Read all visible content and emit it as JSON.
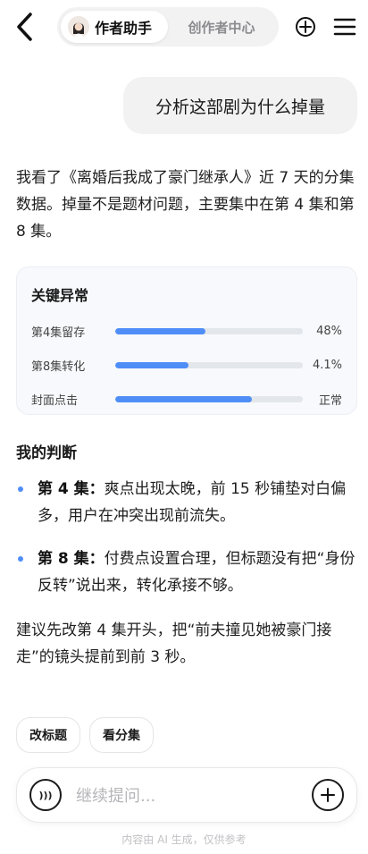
{
  "header": {
    "active_tab": "作者助手",
    "inactive_tab": "创作者中心",
    "icons": {
      "back": "back-chevron-icon",
      "add": "plus-circle-icon",
      "menu": "menu-icon"
    }
  },
  "chat": {
    "user_message": "分析这部剧为什么掉量",
    "answer_intro": "我看了《离婚后我成了豪门继承人》近 7 天的分集数据。掉量不是题材问题，主要集中在第 4 集和第 8 集。",
    "anomalies": {
      "title": "关键异常",
      "rows": [
        {
          "name": "第4集留存",
          "value": "48%",
          "fill": 0.48
        },
        {
          "name": "第8集转化",
          "value": "4.1%",
          "fill": 0.39
        },
        {
          "name": "封面点击",
          "value": "正常",
          "fill": 0.73
        }
      ]
    },
    "judgment_title": "我的判断",
    "judgments": [
      {
        "label": "第 4 集：",
        "text": "爽点出现太晚，前 15 秒铺垫对白偏多，用户在冲突出现前流失。"
      },
      {
        "label": "第 8 集：",
        "text": "付费点设置合理，但标题没有把“身份反转”说出来，转化承接不够。"
      }
    ],
    "suggestion": "建议先改第 4 集开头，把“前夫撞见她被豪门接走”的镜头提前到前 3 秒。"
  },
  "quick_actions": [
    "改标题",
    "看分集"
  ],
  "input": {
    "placeholder": "继续提问...",
    "voice_label": ")))"
  },
  "disclaimer": "内容由 AI 生成，仅供参考",
  "colors": {
    "accent": "#4f8ef7",
    "bubble": "#f2f2f3",
    "card": "#f7f9fc"
  }
}
